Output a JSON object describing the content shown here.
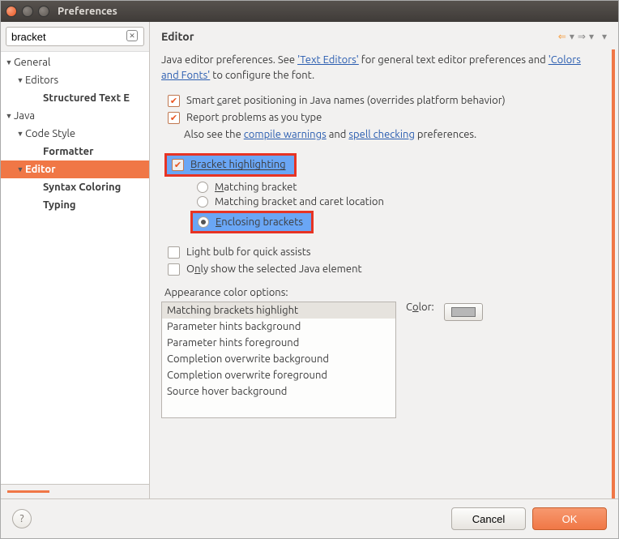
{
  "window": {
    "title": "Preferences"
  },
  "search": {
    "value": "bracket"
  },
  "tree": {
    "general": "General",
    "editors": "Editors",
    "structured": "Structured Text E",
    "java": "Java",
    "codestyle": "Code Style",
    "formatter": "Formatter",
    "editor": "Editor",
    "syntax": "Syntax Coloring",
    "typing": "Typing"
  },
  "header": {
    "title": "Editor"
  },
  "desc": {
    "prefix": "Java editor preferences. See ",
    "link1": "'Text Editors'",
    "mid": " for general text editor preferences and ",
    "link2": "'Colors and Fonts'",
    "suffix": " to configure the font."
  },
  "opts": {
    "smart_caret": "Smart caret positioning in Java names (overrides platform behavior)",
    "report": "Report problems as you type",
    "also_prefix": "Also see the ",
    "also_link1": "compile warnings",
    "also_mid": " and ",
    "also_link2": "spell checking",
    "also_suffix": " preferences.",
    "bracket": "Bracket highlighting",
    "matching": "Matching bracket",
    "matching_caret": "Matching bracket and caret location",
    "enclosing": "Enclosing brackets",
    "lightbulb": "Light bulb for quick assists",
    "onlyshow": "Only show the selected Java element"
  },
  "appearance": {
    "label": "Appearance color options:",
    "items": [
      "Matching brackets highlight",
      "Parameter hints background",
      "Parameter hints foreground",
      "Completion overwrite background",
      "Completion overwrite foreground",
      "Source hover background"
    ],
    "color_label": "Color:"
  },
  "footer": {
    "cancel": "Cancel",
    "ok": "OK"
  }
}
